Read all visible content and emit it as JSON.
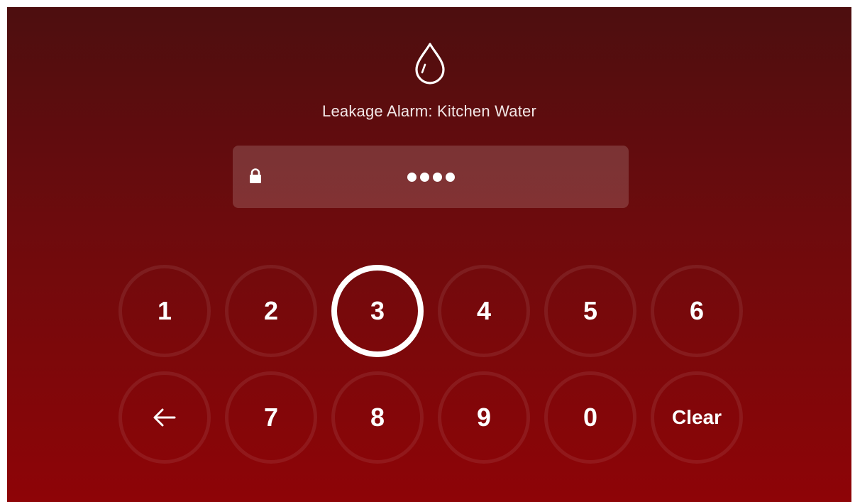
{
  "alarm": {
    "icon": "water-drop-icon",
    "title": "Leakage Alarm: Kitchen Water"
  },
  "pin_field": {
    "icon": "lock-icon",
    "entered_digit_count": 4
  },
  "keypad": {
    "row1": [
      "1",
      "2",
      "3",
      "4",
      "5",
      "6"
    ],
    "row2": {
      "back_icon": "arrow-left-icon",
      "digits": [
        "7",
        "8",
        "9",
        "0"
      ],
      "clear_label": "Clear"
    },
    "active_key": "3"
  },
  "colors": {
    "background_top": "#4d0e0f",
    "background_bottom": "#8e0407",
    "text": "#ffffff"
  }
}
